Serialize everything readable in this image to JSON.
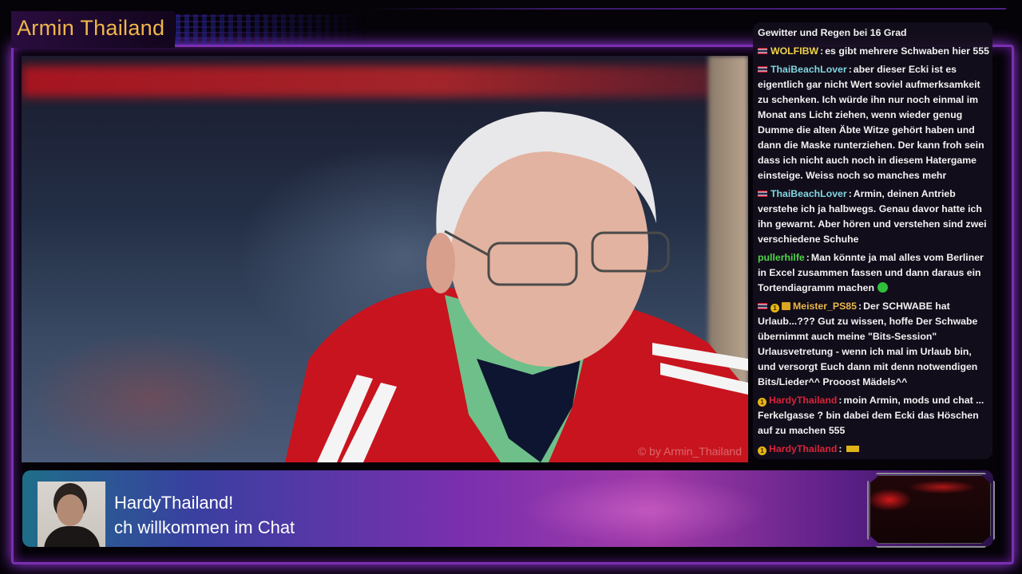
{
  "stream": {
    "title": "Armin Thailand",
    "watermark": "© by Armin_Thailand"
  },
  "chat": {
    "top_line": "Gewitter und Regen bei 16 Grad",
    "messages": [
      {
        "user": "WOLFIBW",
        "color": "#f0d44a",
        "badges": [
          "flag"
        ],
        "text": "es gibt mehrere Schwaben hier 555"
      },
      {
        "user": "ThaiBeachLover",
        "color": "#7fd6e0",
        "badges": [
          "flag"
        ],
        "text": "aber dieser Ecki ist es eigentlich gar nicht Wert soviel aufmerksamkeit zu schenken. Ich würde ihn nur noch einmal im Monat ans Licht ziehen, wenn wieder genug Dumme die alten Äbte Witze gehört haben und dann die Maske runterziehen. Der kann froh sein dass ich nicht auch noch in diesem Hatergame einsteige. Weiss noch so manches mehr"
      },
      {
        "user": "ThaiBeachLover",
        "color": "#7fd6e0",
        "badges": [
          "flag"
        ],
        "text": "Armin, deinen Antrieb verstehe ich ja halbwegs. Genau davor hatte ich ihn gewarnt. Aber hören und verstehen sind zwei verschiedene Schuhe"
      },
      {
        "user": "pullerhilfe",
        "color": "#4fd44a",
        "badges": [],
        "text": "Man könnte ja mal alles vom Berliner in Excel zusammen fassen und dann daraus ein Tortendiagramm machen",
        "trailing_icon": "emote"
      },
      {
        "user": "Meister_PS85",
        "color": "#e8b84a",
        "badges": [
          "flag",
          "badge-1",
          "crown"
        ],
        "text": "Der SCHWABE hat Urlaub...??? Gut zu wissen, hoffe Der Schwabe übernimmt auch meine \"Bits-Session\" Urlausvetretung - wenn ich mal im Urlaub bin, und versorgt Euch dann mit denn notwendigen Bits/Lieder^^ Prooost Mädels^^"
      },
      {
        "user": "HardyThailand",
        "color": "#d8233a",
        "badges": [
          "badge-1"
        ],
        "text": "moin Armin, mods und chat ... Ferkelgasse ? bin dabei dem Ecki das Höschen auf zu machen 555"
      },
      {
        "user": "HardyThailand",
        "color": "#d8233a",
        "badges": [
          "badge-1"
        ],
        "text": "",
        "trailing_icon": "bits"
      }
    ]
  },
  "banner": {
    "line1": "HardyThailand!",
    "line2": "ch willkommen im Chat"
  }
}
